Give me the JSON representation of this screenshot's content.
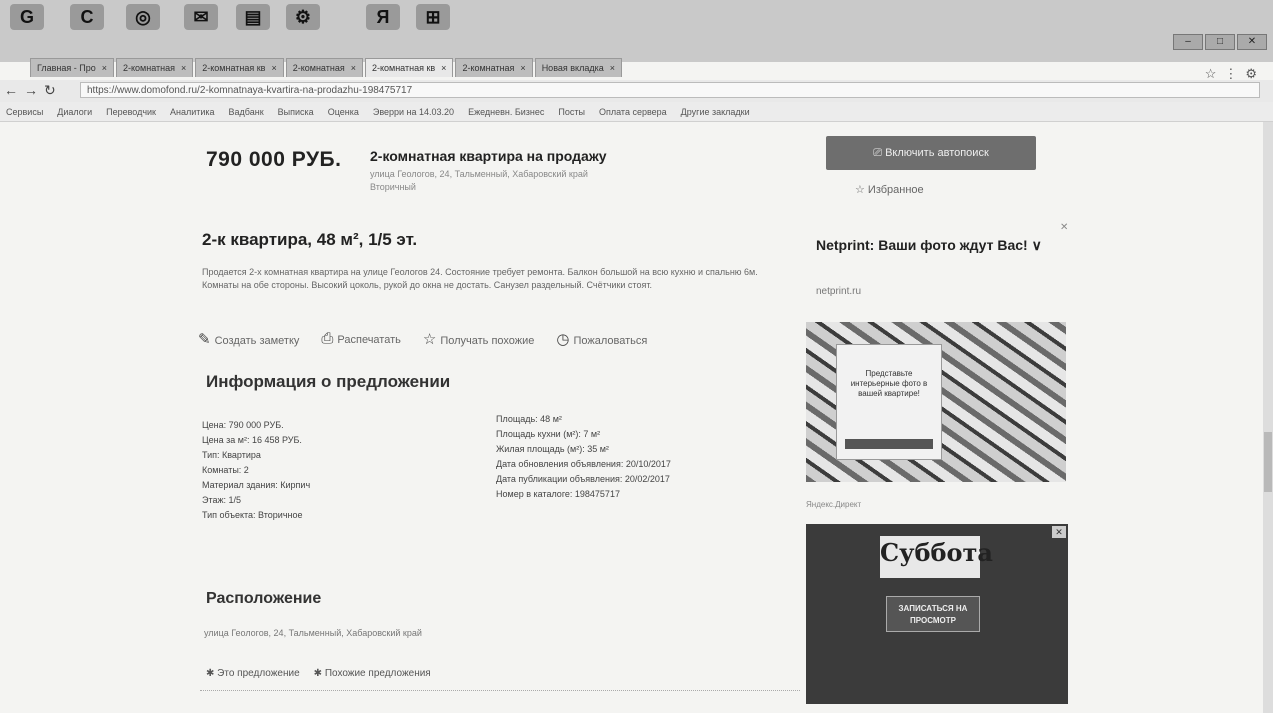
{
  "browser": {
    "app_icons": [
      "G",
      "С",
      "◎",
      "✉",
      "▤",
      "⚙",
      "Я",
      "⊞"
    ],
    "tabs": [
      {
        "label": "Главная - Про"
      },
      {
        "label": "2-комнатная"
      },
      {
        "label": "2-комнатная кв"
      },
      {
        "label": "2-комнатная"
      },
      {
        "label": "2-комнатная кв",
        "active": true
      },
      {
        "label": "2-комнатная"
      },
      {
        "label": "Новая вкладка"
      }
    ],
    "url": "https://www.domofond.ru/2-komnatnaya-kvartira-na-prodazhu-198475717",
    "bookmarks": [
      "Сервисы",
      "Диалоги",
      "Переводчик",
      "Аналитика",
      "Bадбанк",
      "Bыписка",
      "Оценка",
      "Эверри на 14.03.20",
      "Ежедневн. Бизнес",
      "Посты",
      "Оплата сервера",
      "Другие закладки"
    ]
  },
  "listing": {
    "price": "790 000 РУБ.",
    "title": "2-комнатная квартира на продажу",
    "address_line1": "улица Геологов, 24, Тальменный, Хабаровский край",
    "address_line2": "Вторичный",
    "subtitle": "2-к квартира, 48 м², 1/5 эт.",
    "description": "Продается 2-х комнатная квартира на улице Геологов 24. Состояние требует ремонта. Балкон большой на всю кухню и спальню 6м. Комнаты на обе стороны. Высокий цоколь, рукой до окна не достать. Санузел раздельный. Счётчики стоят.",
    "actions": [
      {
        "icon": "✎",
        "label": "Создать заметку"
      },
      {
        "icon": "⎙",
        "label": "Распечатать"
      },
      {
        "icon": "☆",
        "label": "Получать похожие"
      },
      {
        "icon": "◷",
        "label": "Пожаловаться"
      }
    ]
  },
  "info": {
    "heading": "Информация о предложении",
    "left": [
      "Цена: 790 000 РУБ.",
      "Цена за м²: 16 458 РУБ.",
      "Тип: Квартира",
      "Комнаты: 2",
      "Материал здания: Кирпич",
      "Этаж: 1/5",
      "Тип объекта: Вторичное"
    ],
    "right": [
      "Площадь: 48 м²",
      "Площадь кухни (м²): 7 м²",
      "Жилая площадь (м²): 35 м²",
      "Дата обновления объявления: 20/10/2017",
      "Дата публикации объявления: 20/02/2017",
      "Номер в каталоге: 198475717"
    ]
  },
  "location": {
    "heading": "Расположение",
    "address": "улица Геологов, 24, Тальменный, Хабаровский край",
    "links": [
      "Это предложение",
      "Похожие предложения"
    ]
  },
  "sidebar": {
    "auto_button": "Включить автопоиск",
    "favorite": "Избранное",
    "ad_title": "Netprint: Ваши фото ждут Вас! ∨",
    "ad_site": "netprint.ru",
    "ad_card_text": "Представьте интерьерные фото в вашей квартире!",
    "ad_small": "Яндекс.Директ",
    "banner_title": "Суббота",
    "banner_button": "ЗАПИСАТЬСЯ НА ПРОСМОТР"
  }
}
